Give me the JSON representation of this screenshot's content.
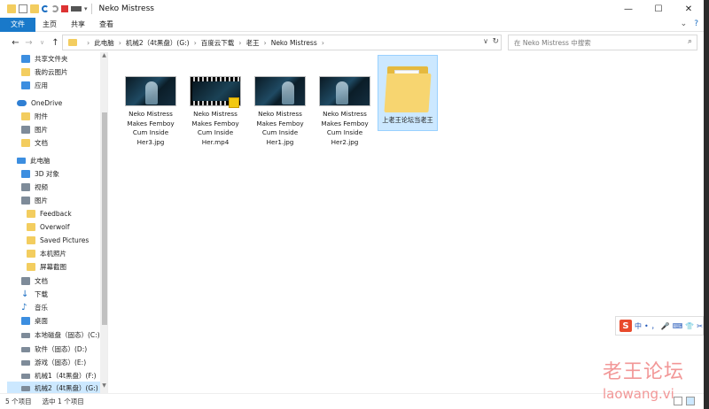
{
  "window": {
    "title": "Neko Mistress",
    "controls": [
      "—",
      "☐",
      "✕"
    ]
  },
  "ribbon": {
    "tabs": [
      "文件",
      "主页",
      "共享",
      "查看"
    ]
  },
  "address": {
    "crumbs": [
      "此电脑",
      "机械2（4t黑盘）(G:)",
      "百度云下载",
      "老王",
      "Neko Mistress"
    ],
    "search_placeholder": "在 Neko Mistress 中搜索"
  },
  "sidebar": {
    "items": [
      {
        "label": "共享文件夹",
        "icon": "share-folder-icon",
        "color": "#3c8ee0"
      },
      {
        "label": "我的云图片",
        "icon": "folder-icon",
        "color": "#f3cd5f"
      },
      {
        "label": "应用",
        "icon": "apps-icon",
        "color": "#3c8ee0"
      },
      {
        "label": "OneDrive",
        "icon": "onedrive-cloud-icon",
        "color": "#2f7fd3"
      },
      {
        "label": "附件",
        "icon": "folder-icon",
        "color": "#f3cd5f"
      },
      {
        "label": "图片",
        "icon": "pictures-icon",
        "color": "#7e8b99"
      },
      {
        "label": "文档",
        "icon": "folder-icon",
        "color": "#f3cd5f"
      },
      {
        "label": "此电脑",
        "icon": "this-pc-icon",
        "color": "#3c8ee0"
      },
      {
        "label": "3D 对象",
        "icon": "3d-objects-icon",
        "color": "#3c8ee0"
      },
      {
        "label": "视频",
        "icon": "videos-icon",
        "color": "#7e8b99"
      },
      {
        "label": "图片",
        "icon": "pictures-icon",
        "color": "#7e8b99"
      },
      {
        "label": "Feedback",
        "icon": "folder-icon",
        "color": "#f3cd5f"
      },
      {
        "label": "Overwolf",
        "icon": "folder-icon",
        "color": "#f3cd5f"
      },
      {
        "label": "Saved Pictures",
        "icon": "folder-icon",
        "color": "#f3cd5f"
      },
      {
        "label": "本机照片",
        "icon": "folder-icon",
        "color": "#f3cd5f"
      },
      {
        "label": "屏幕截图",
        "icon": "folder-icon",
        "color": "#f3cd5f"
      },
      {
        "label": "文档",
        "icon": "documents-icon",
        "color": "#7e8b99"
      },
      {
        "label": "下载",
        "icon": "downloads-icon",
        "color": "#3c8ee0"
      },
      {
        "label": "音乐",
        "icon": "music-icon",
        "color": "#3c8ee0"
      },
      {
        "label": "桌面",
        "icon": "desktop-icon",
        "color": "#3c8ee0"
      },
      {
        "label": "本地磁盘（固态）(C:)",
        "icon": "drive-icon",
        "color": "#7e8b99"
      },
      {
        "label": "软件（固态）(D:)",
        "icon": "drive-icon",
        "color": "#7e8b99"
      },
      {
        "label": "游戏（固态）(E:)",
        "icon": "drive-icon",
        "color": "#7e8b99"
      },
      {
        "label": "机械1（4t黑盘）(F:)",
        "icon": "drive-icon",
        "color": "#7e8b99"
      },
      {
        "label": "机械2（4t黑盘）(G:)",
        "icon": "drive-icon",
        "color": "#7e8b99"
      }
    ]
  },
  "files": [
    {
      "name": "Neko Mistress Makes Femboy Cum Inside Her3.jpg",
      "type": "image"
    },
    {
      "name": "Neko Mistress Makes Femboy Cum Inside Her.mp4",
      "type": "video"
    },
    {
      "name": "Neko Mistress Makes Femboy Cum Inside Her1.jpg",
      "type": "image"
    },
    {
      "name": "Neko Mistress Makes Femboy Cum Inside Her2.jpg",
      "type": "image"
    },
    {
      "name": "上老王论坛当老王",
      "type": "folder",
      "selected": true
    }
  ],
  "status": {
    "count": "5 个项目",
    "selected": "选中 1 个项目"
  },
  "ime": {
    "logo": "S",
    "lang": "中",
    "items": [
      "•",
      "，",
      "🎤",
      "⌨",
      "👕",
      "✂"
    ]
  },
  "watermark": {
    "cn": "老王论坛",
    "en": "laowang.vi"
  }
}
